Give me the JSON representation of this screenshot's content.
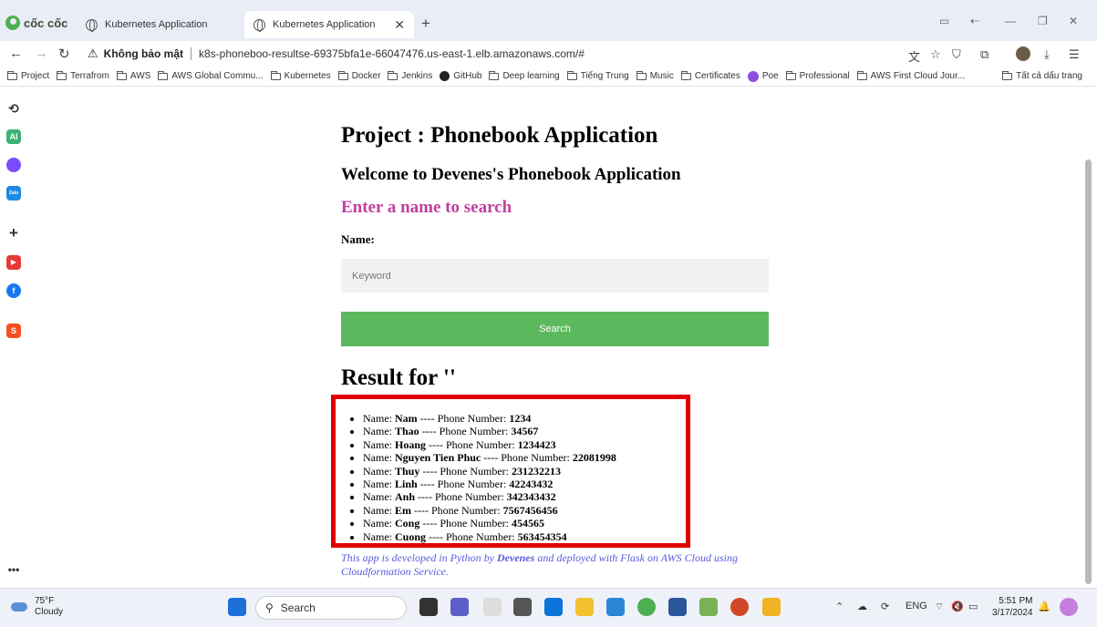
{
  "browser": {
    "brand": "cốc cốc",
    "tabs": [
      {
        "title": "Kubernetes Application"
      },
      {
        "title": "Kubernetes Application"
      }
    ],
    "security_label": "Không bảo mật",
    "url": "k8s-phoneboo-resultse-69375bfa1e-66047476.us-east-1.elb.amazonaws.com/#"
  },
  "bookmarks": [
    "Project",
    "Terrafrom",
    "AWS",
    "AWS Global Commu...",
    "Kubernetes",
    "Docker",
    "Jenkins",
    "GitHub",
    "Deep learning",
    "Tiếng Trung",
    "Music",
    "Certificates",
    "Poe",
    "Professional",
    "AWS First Cloud Jour..."
  ],
  "all_bookmarks": "Tất cả dấu trang",
  "page": {
    "title": "Project : Phonebook Application",
    "welcome": "Welcome to Devenes's Phonebook Application",
    "prompt": "Enter a name to search",
    "name_label": "Name:",
    "keyword_placeholder": "Keyword",
    "search_button": "Search",
    "result_heading": "Result for ''",
    "name_prefix": "Name:",
    "phone_prefix": "---- Phone Number:",
    "results": [
      {
        "name": "Nam",
        "phone": "1234"
      },
      {
        "name": "Thao",
        "phone": "34567"
      },
      {
        "name": "Hoang",
        "phone": "1234423"
      },
      {
        "name": "Nguyen Tien Phuc",
        "phone": "22081998"
      },
      {
        "name": "Thuy",
        "phone": "231232213"
      },
      {
        "name": "Linh",
        "phone": "42243432"
      },
      {
        "name": "Anh",
        "phone": "342343432"
      },
      {
        "name": "Em",
        "phone": "7567456456"
      },
      {
        "name": "Cong",
        "phone": "454565"
      },
      {
        "name": "Cuong",
        "phone": "563454354"
      }
    ],
    "footer_pre": "This app is developed in Python by",
    "footer_author": "Devenes",
    "footer_post": "and deployed with Flask on AWS Cloud using Cloudformation Service.",
    "highlight_color": "#e00000"
  },
  "taskbar": {
    "temperature": "75°F",
    "condition": "Cloudy",
    "search": "Search",
    "language": "ENG",
    "time": "5:51 PM",
    "date": "3/17/2024"
  },
  "sidebar_labels": {
    "ai": "AI",
    "zalo": "Zalo"
  }
}
